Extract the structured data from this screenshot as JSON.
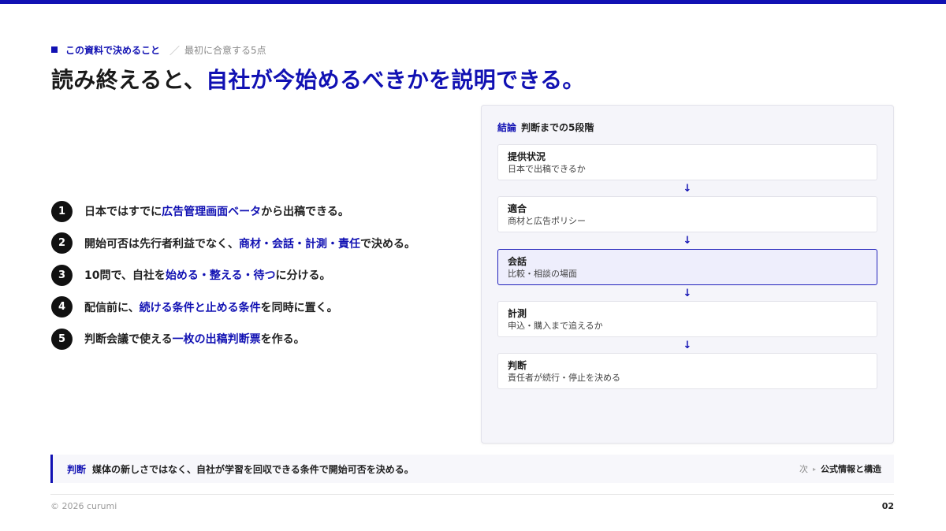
{
  "theme": {
    "accent": "#1111b3",
    "text": "#1c1c1c",
    "panel_bg": "#f5f5fa"
  },
  "eyebrow": {
    "label": "この資料で決めること",
    "slash": "／",
    "sub": "最初に合意する5点"
  },
  "headline": {
    "prefix": "読み終えると、",
    "accent": "自社が今始めるべきかを説明できる。"
  },
  "points": [
    {
      "num": "1",
      "a": "日本ではすでに",
      "b": "広告管理画面ベータ",
      "c": "から出稿できる。"
    },
    {
      "num": "2",
      "a": "開始可否は先行者利益でなく、",
      "b": "商材・会話・計測・責任",
      "c": "で決める。"
    },
    {
      "num": "3",
      "a": "10問で、自社を",
      "b": "始める・整える・待つ",
      "c": "に分ける。"
    },
    {
      "num": "4",
      "a": "配信前に、",
      "b": "続ける条件と止める条件",
      "c": "を同時に置く。"
    },
    {
      "num": "5",
      "a": "判断会議で使える",
      "b": "一枚の出稿判断票",
      "c": "を作る。"
    }
  ],
  "panel": {
    "tag": "結論",
    "title": "判断までの5段階",
    "arrow": "↓",
    "steps": [
      {
        "title": "提供状況",
        "sub": "日本で出稿できるか"
      },
      {
        "title": "適合",
        "sub": "商材と広告ポリシー"
      },
      {
        "title": "会話",
        "sub": "比較・相談の場面"
      },
      {
        "title": "計測",
        "sub": "申込・購入まで追えるか"
      },
      {
        "title": "判断",
        "sub": "責任者が続行・停止を決める"
      }
    ]
  },
  "judgment": {
    "label": "判断",
    "text": "媒体の新しさではなく、自社が学習を回収できる条件で開始可否を決める。",
    "next_label": "次",
    "next_arrow": "▸",
    "next_title": "公式情報と構造"
  },
  "footer": {
    "copyright": "© 2026 curumi",
    "page": "02"
  }
}
